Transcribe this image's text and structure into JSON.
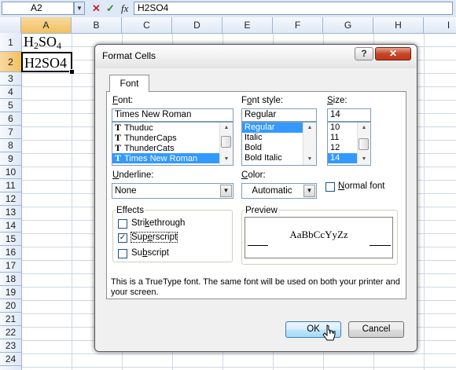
{
  "formula_bar": {
    "name_box": "A2",
    "cancel_glyph": "✕",
    "enter_glyph": "✓",
    "insert_function_glyph": "fx",
    "formula": "H2SO4"
  },
  "sheet": {
    "columns": [
      "A",
      "B",
      "C",
      "D",
      "E",
      "F",
      "G",
      "H",
      "I"
    ],
    "rows": [
      "1",
      "2",
      "3",
      "4",
      "5",
      "6",
      "7",
      "8",
      "9",
      "10",
      "11",
      "12",
      "13",
      "14",
      "15",
      "16",
      "17",
      "18",
      "19",
      "20",
      "21",
      "22",
      "23",
      "24"
    ],
    "a1": {
      "part1": "H",
      "sub1": "2",
      "part2": "SO",
      "sub2": "4"
    },
    "a2": "H2SO4"
  },
  "dialog": {
    "title": "Format Cells",
    "help": "?",
    "close": "✕",
    "tab": "Font",
    "font": {
      "label_u": "F",
      "label_rest": "ont:",
      "value": "Times New Roman",
      "items": [
        "Thuduc",
        "ThunderCaps",
        "ThunderCats",
        "Times New Roman"
      ],
      "selected_index": 3
    },
    "font_style": {
      "label_pre": "F",
      "label_u": "o",
      "label_rest": "nt style:",
      "value": "Regular",
      "items": [
        "Regular",
        "Italic",
        "Bold",
        "Bold Italic"
      ],
      "selected_index": 0
    },
    "size": {
      "label_u": "S",
      "label_rest": "ize:",
      "value": "14",
      "items": [
        "10",
        "11",
        "12",
        "14"
      ],
      "selected_index": 3
    },
    "underline": {
      "label_u": "U",
      "label_rest": "nderline:",
      "value": "None"
    },
    "color": {
      "label_u": "C",
      "label_rest": "olor:",
      "value": "Automatic"
    },
    "normal_font": {
      "label_u": "N",
      "label_rest": "ormal font",
      "checked": false
    },
    "effects": {
      "title": "Effects",
      "strikethrough": {
        "pre": "Stri",
        "u": "k",
        "rest": "ethrough",
        "checked": false
      },
      "superscript": {
        "pre": "Sup",
        "u": "e",
        "rest": "rscript",
        "checked": true
      },
      "subscript": {
        "pre": "Su",
        "u": "b",
        "rest": "script",
        "checked": false
      }
    },
    "preview": {
      "title": "Preview",
      "sample": "AaBbCcYyZz"
    },
    "info_text": "This is a TrueType font.  The same font will be used on both your printer and your screen.",
    "ok": "OK",
    "cancel": "Cancel"
  }
}
